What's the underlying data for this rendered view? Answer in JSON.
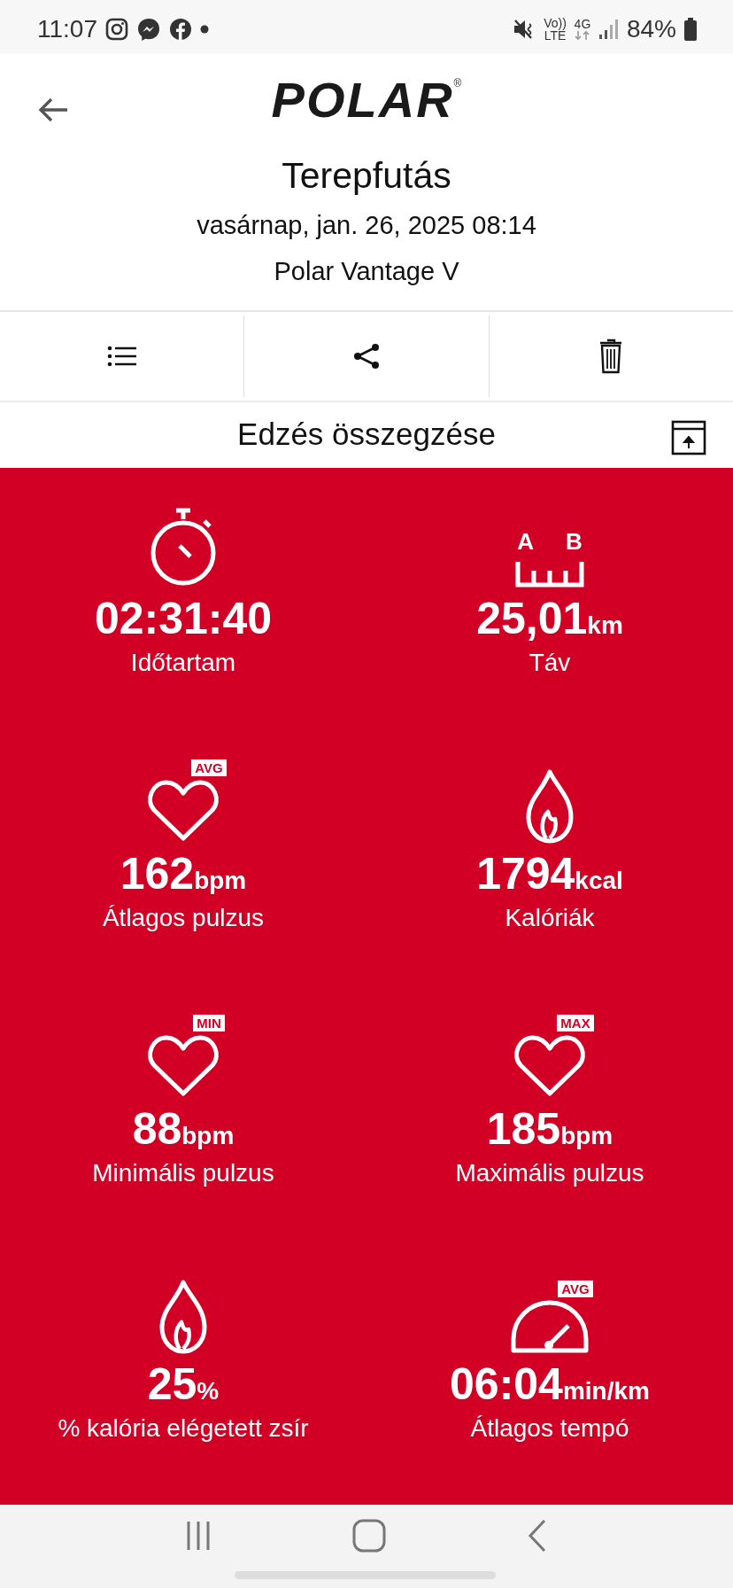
{
  "status_bar": {
    "time": "11:07",
    "volte_top": "Vo))",
    "volte_bottom": "LTE",
    "network": "4G",
    "battery": "84%"
  },
  "header": {
    "logo": "POLAR",
    "logo_mark": "®"
  },
  "workout": {
    "title": "Terepfutás",
    "date": "vasárnap, jan. 26, 2025 08:14",
    "device": "Polar Vantage V"
  },
  "toolbar": [
    {
      "kind": "list"
    },
    {
      "kind": "share"
    },
    {
      "kind": "delete"
    }
  ],
  "section_title": "Edzés összegzése",
  "stat_rows": [
    {
      "items": [
        {
          "kind": "stopwatch",
          "value": "02:31:40",
          "label": "Időtartam"
        },
        {
          "kind": "distance",
          "icon_labels": [
            "A",
            "B"
          ],
          "value": "25,01",
          "unit": "km",
          "label": "Táv"
        }
      ]
    },
    {
      "items": [
        {
          "kind": "heart",
          "badge": "AVG",
          "value": "162",
          "unit": "bpm",
          "label": "Átlagos pulzus"
        },
        {
          "kind": "flame",
          "value": "1794",
          "unit": "kcal",
          "label": "Kalóriák"
        }
      ]
    },
    {
      "items": [
        {
          "kind": "heart",
          "badge": "MIN",
          "value": "88",
          "unit": "bpm",
          "label": "Minimális pulzus"
        },
        {
          "kind": "heart",
          "badge": "MAX",
          "value": "185",
          "unit": "bpm",
          "label": "Maximális pulzus"
        }
      ]
    },
    {
      "items": [
        {
          "kind": "flame",
          "value": "25",
          "unit": "%",
          "label": "% kalória elégetett zsír"
        },
        {
          "kind": "gauge",
          "badge": "AVG",
          "value": "06:04",
          "unit": "min/km",
          "label": "Átlagos tempó"
        }
      ]
    }
  ]
}
